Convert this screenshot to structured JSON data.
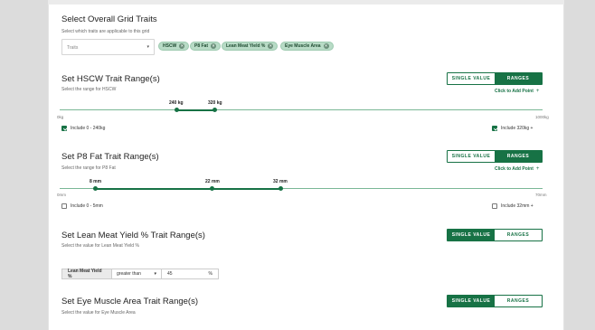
{
  "overall": {
    "title": "Select Overall Grid Traits",
    "subtitle": "Select which traits are applicable to this grid",
    "traits_placeholder": "Traits",
    "chips": [
      "HSCW",
      "P8 Fat",
      "Lean Meat Yield %",
      "Eye Muscle Area"
    ]
  },
  "toggle": {
    "single": "SINGLE VALUE",
    "ranges": "RANGES"
  },
  "add_point": "Click to Add Point",
  "hscw": {
    "title": "Set HSCW Trait Range(s)",
    "subtitle": "Select the range for HSCW",
    "mode": "ranges",
    "min_label": "0kg",
    "max_label": "1000kg",
    "points": [
      {
        "label": "240 kg",
        "value": 240
      },
      {
        "label": "320 kg",
        "value": 320
      }
    ],
    "include_low": {
      "label": "Include 0 - 240kg",
      "checked": true
    },
    "include_high": {
      "label": "Include 320kg +",
      "checked": true
    }
  },
  "p8": {
    "title": "Set P8 Fat Trait Range(s)",
    "subtitle": "Select the range for P8 Fat",
    "mode": "ranges",
    "min_label": "0mm",
    "max_label": "70mm",
    "points": [
      {
        "label": "8 mm",
        "value": 8
      },
      {
        "label": "22 mm",
        "value": 22
      },
      {
        "label": "32 mm",
        "value": 32
      }
    ],
    "include_low": {
      "label": "Include 0 - 5mm",
      "checked": false
    },
    "include_high": {
      "label": "Include 32mm +",
      "checked": false
    }
  },
  "lmy": {
    "title": "Set Lean Meat Yield % Trait Range(s)",
    "subtitle": "Select the value for Lean Meat Yield %",
    "mode": "single",
    "field_label": "Lean Meat Yield %",
    "comparator": "greater than",
    "value": "45",
    "unit": "%"
  },
  "ema": {
    "title": "Set Eye Muscle Area Trait Range(s)",
    "subtitle": "Select the value for Eye Muscle Area",
    "mode": "single"
  },
  "colors": {
    "accent": "#177245",
    "chip_bg": "#b8dbc6",
    "track": "#7ab896"
  }
}
